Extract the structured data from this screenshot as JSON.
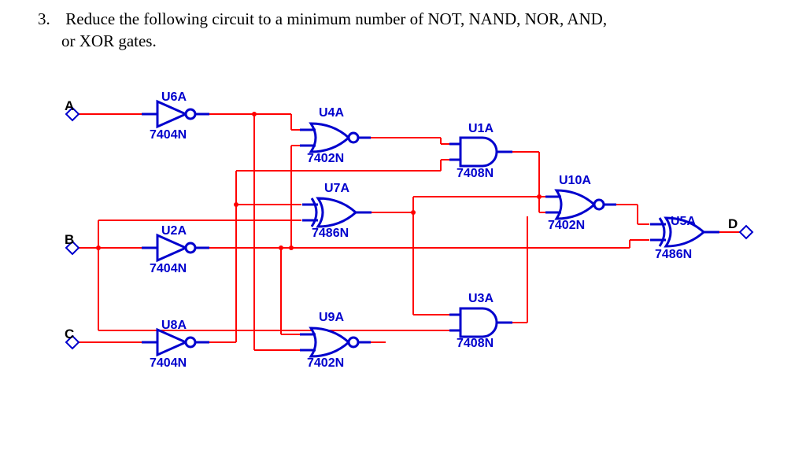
{
  "question": {
    "number": "3.",
    "text_line1": "Reduce the following circuit to a minimum number of NOT, NAND, NOR, AND,",
    "text_line2": "or XOR gates."
  },
  "inputs": {
    "A": "A",
    "B": "B",
    "C": "C"
  },
  "output": {
    "D": "D"
  },
  "gates": {
    "U6A": {
      "ref": "U6A",
      "part": "7404N"
    },
    "U2A": {
      "ref": "U2A",
      "part": "7404N"
    },
    "U8A": {
      "ref": "U8A",
      "part": "7404N"
    },
    "U4A": {
      "ref": "U4A",
      "part": "7402N"
    },
    "U7A": {
      "ref": "U7A",
      "part": "7486N"
    },
    "U9A": {
      "ref": "U9A",
      "part": "7402N"
    },
    "U1A": {
      "ref": "U1A",
      "part": "7408N"
    },
    "U3A": {
      "ref": "U3A",
      "part": "7408N"
    },
    "U10A": {
      "ref": "U10A",
      "part": "7402N"
    },
    "U5A": {
      "ref": "U5A",
      "part": "7486N"
    }
  }
}
